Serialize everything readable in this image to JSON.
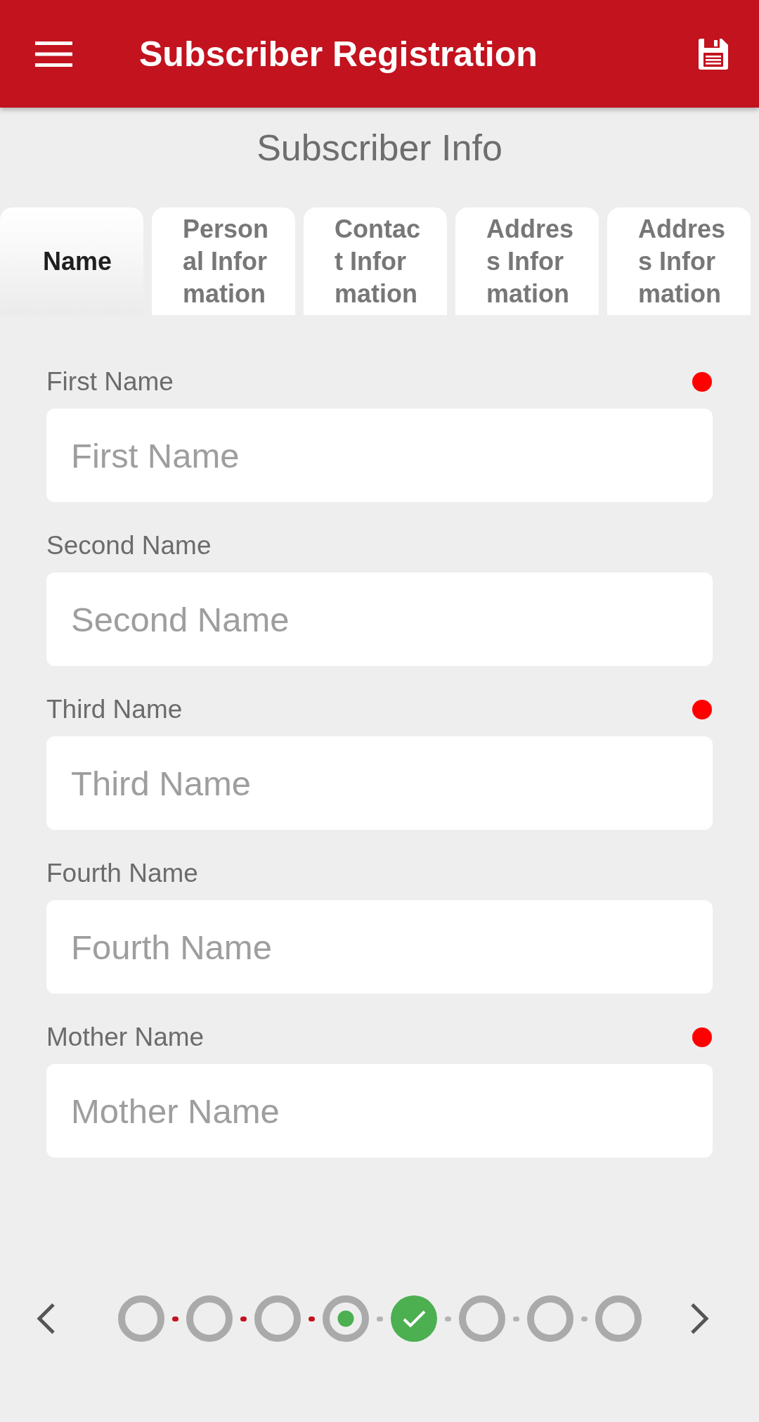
{
  "app_bar": {
    "title": "Subscriber Registration"
  },
  "section_title": "Subscriber Info",
  "tabs": [
    {
      "label": "Name",
      "selected": true
    },
    {
      "label": "Personal Information",
      "selected": false
    },
    {
      "label": "Contact Information",
      "selected": false
    },
    {
      "label": "Address Information",
      "selected": false
    },
    {
      "label": "Address Information",
      "selected": false
    }
  ],
  "fields": [
    {
      "label": "First Name",
      "placeholder": "First Name",
      "required": true
    },
    {
      "label": "Second Name",
      "placeholder": "Second Name",
      "required": false
    },
    {
      "label": "Third Name",
      "placeholder": "Third Name",
      "required": true
    },
    {
      "label": "Fourth Name",
      "placeholder": "Fourth Name",
      "required": false
    },
    {
      "label": "Mother Name",
      "placeholder": "Mother Name",
      "required": true
    }
  ],
  "stepper": {
    "steps": [
      {
        "kind": "empty"
      },
      {
        "kind": "empty"
      },
      {
        "kind": "empty"
      },
      {
        "kind": "current"
      },
      {
        "kind": "done"
      },
      {
        "kind": "empty"
      },
      {
        "kind": "empty"
      },
      {
        "kind": "empty"
      }
    ],
    "connectors": [
      {
        "highlighted": true
      },
      {
        "highlighted": true
      },
      {
        "highlighted": true
      },
      {
        "highlighted": false
      },
      {
        "highlighted": false
      },
      {
        "highlighted": false
      },
      {
        "highlighted": false
      }
    ]
  }
}
